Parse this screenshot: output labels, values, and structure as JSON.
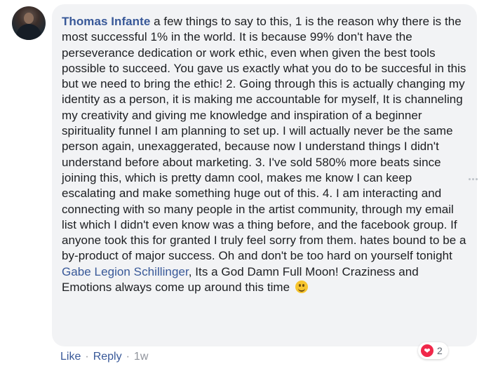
{
  "comment": {
    "author": "Thomas Infante",
    "body": "a few things to say to this, 1 is the reason why there is the most successful 1% in the world. It is because 99% don't have the perseverance dedication or work ethic, even when given the best tools possible to succeed. You gave us exactly what you do to be succesful in this but we need to bring the ethic! 2. Going through this is actually changing my identity as a person, it is making me accountable for myself, It is channeling my creativity and giving me knowledge and inspiration of a beginner spirituality funnel I am planning to set up. I will actually never be the same person again, unexaggerated, because now I understand things I didn't understand before about marketing. 3. I've sold 580% more beats since joining this, which is pretty damn cool, makes me know I can keep escalating and make something huge out of this. 4. I am interacting and connecting with so many people in the artist community, through my email list which I didn't even know was a thing before, and the facebook group. If anyone took this for granted I truly feel sorry from them. hates bound to be a by-product of major success. Oh and don't be too hard on yourself tonight",
    "tagged_user": "Gabe Legion Schillinger",
    "body_after": ", Its a God Damn Full Moon! Craziness and Emotions always come up around this time",
    "emoji": "slightly-smiling-face",
    "reaction_type": "love",
    "reaction_count": "2"
  },
  "actions": {
    "like": "Like",
    "reply": "Reply",
    "separator": "·",
    "timestamp": "1w"
  },
  "icons": {
    "more": "more-options-icon",
    "heart": "heart-reaction-icon"
  },
  "colors": {
    "bubble_bg": "#f2f3f5",
    "link": "#385898",
    "love": "#f0284a",
    "text": "#1c1e21"
  }
}
